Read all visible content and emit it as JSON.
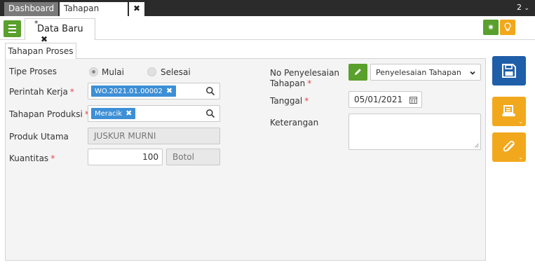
{
  "top_tabs": {
    "dashboard": "Dashboard",
    "active": "Tahapan Proses",
    "close": "✖",
    "count": "2"
  },
  "doc_tab": {
    "modified_marker": "*",
    "label": "Data Baru",
    "close": "✖"
  },
  "section_tab": "Tahapan Proses",
  "form": {
    "tipe_proses": {
      "label": "Tipe Proses",
      "options": [
        "Mulai",
        "Selesai"
      ],
      "selected": "Mulai"
    },
    "perintah_kerja": {
      "label": "Perintah Kerja",
      "required_mark": "*",
      "chip": "WO.2021.01.00002",
      "chip_close": "✖"
    },
    "tahapan_produksi": {
      "label": "Tahapan Produksi",
      "required_mark": "*",
      "chip": "Meracik",
      "chip_close": "✖"
    },
    "produk_utama": {
      "label": "Produk Utama",
      "value": "JUSKUR MURNI"
    },
    "kuantitas": {
      "label": "Kuantitas",
      "required_mark": "*",
      "value": "100",
      "unit": "Botol"
    },
    "no_penyelesaian": {
      "label_line1": "No Penyelesaian",
      "label_line2": "Tahapan",
      "required_mark": "*",
      "selected": "Penyelesaian Tahapan"
    },
    "tanggal": {
      "label": "Tanggal",
      "required_mark": "*",
      "value": "05/01/2021"
    },
    "keterangan": {
      "label": "Keterangan",
      "value": ""
    }
  },
  "colors": {
    "green": "#5aa02c",
    "orange": "#f2a81d",
    "blue": "#1f5ea8",
    "chip": "#3d8fd6",
    "required": "#e0484f"
  },
  "icons": [
    "menu-icon",
    "gear-icon",
    "lightbulb-icon",
    "search-icon",
    "pencil-icon",
    "calendar-icon",
    "chevron-down-icon",
    "save-icon",
    "print-icon",
    "paperclip-icon"
  ]
}
